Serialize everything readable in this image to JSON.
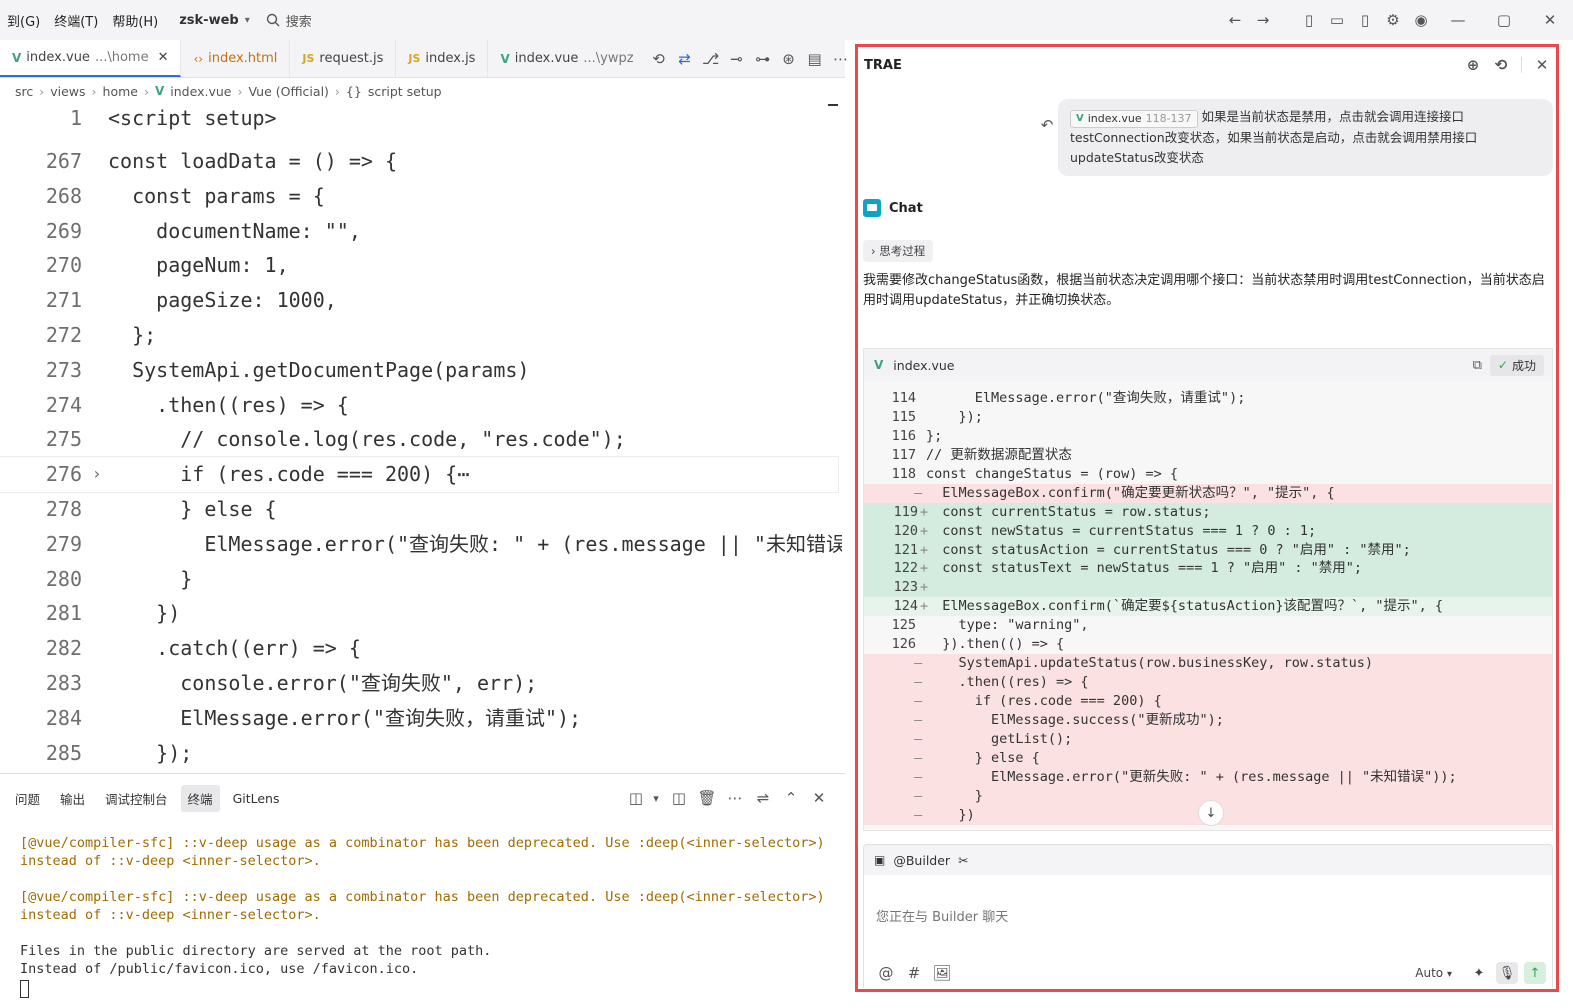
{
  "titlebar": {
    "menus": [
      "到(G)",
      "终端(T)",
      "帮助(H)"
    ],
    "project": "zsk-web",
    "search": "搜索"
  },
  "tabs": [
    {
      "icon": "vue",
      "name": "index.vue",
      "path": "...\\home",
      "active": true
    },
    {
      "icon": "html",
      "name": "index.html",
      "path": ""
    },
    {
      "icon": "js",
      "name": "request.js",
      "path": ""
    },
    {
      "icon": "js",
      "name": "index.js",
      "path": ""
    },
    {
      "icon": "vue",
      "name": "index.vue",
      "path": "...\\ywpz"
    }
  ],
  "breadcrumb": [
    "src",
    "views",
    "home",
    "index.vue",
    "Vue (Official)",
    "script setup"
  ],
  "code": [
    {
      "n": "1",
      "t": "<script setup>"
    },
    {
      "n": "267",
      "t": "const loadData = () => {"
    },
    {
      "n": "268",
      "t": "  const params = {"
    },
    {
      "n": "269",
      "t": "    documentName: \"\","
    },
    {
      "n": "270",
      "t": "    pageNum: 1,"
    },
    {
      "n": "271",
      "t": "    pageSize: 1000,"
    },
    {
      "n": "272",
      "t": "  };"
    },
    {
      "n": "273",
      "t": "  SystemApi.getDocumentPage(params)"
    },
    {
      "n": "274",
      "t": "    .then((res) => {"
    },
    {
      "n": "275",
      "t": "      // console.log(res.code, \"res.code\");"
    },
    {
      "n": "276",
      "t": "      if (res.code === 200) {⋯"
    },
    {
      "n": "278",
      "t": "      } else {"
    },
    {
      "n": "279",
      "t": "        ElMessage.error(\"查询失败: \" + (res.message || \"未知错误"
    },
    {
      "n": "280",
      "t": "      }"
    },
    {
      "n": "281",
      "t": "    })"
    },
    {
      "n": "282",
      "t": "    .catch((err) => {"
    },
    {
      "n": "283",
      "t": "      console.error(\"查询失败\", err);"
    },
    {
      "n": "284",
      "t": "      ElMessage.error(\"查询失败，请重试\");"
    },
    {
      "n": "285",
      "t": "    });"
    }
  ],
  "panel": {
    "tabs": [
      "问题",
      "输出",
      "调试控制台",
      "终端",
      "GitLens"
    ],
    "active": "终端",
    "terminal": [
      "[@vue/compiler-sfc] ::v-deep usage as a combinator has been deprecated. Use :deep(<inner-selector>) instead of ::v-deep <inner-selector>.",
      "",
      "[@vue/compiler-sfc] ::v-deep usage as a combinator has been deprecated. Use :deep(<inner-selector>) instead of ::v-deep <inner-selector>.",
      "",
      "Files in the public directory are served at the root path.",
      "Instead of /public/favicon.ico, use /favicon.ico."
    ]
  },
  "side": {
    "title": "TRAE",
    "user_msg": {
      "chip_file": "index.vue",
      "chip_range": "118-137",
      "text": "如果是当前状态是禁用，点击就会调用连接接口testConnection改变状态，如果当前状态是启动，点击就会调用禁用接口updateStatus改变状态"
    },
    "chat_label": "Chat",
    "thinking": "思考过程",
    "reply": "我需要修改changeStatus函数，根据当前状态决定调用哪个接口：当前状态禁用时调用testConnection，当前状态启用时调用updateStatus，并正确切换状态。",
    "diff_file": "index.vue",
    "diff_status": "成功",
    "diff_lines": [
      {
        "n": "114",
        "m": "",
        "k": "ctx",
        "t": "      ElMessage.error(\"查询失败，请重试\");"
      },
      {
        "n": "115",
        "m": "",
        "k": "ctx",
        "t": "    });"
      },
      {
        "n": "116",
        "m": "",
        "k": "ctx",
        "t": "};"
      },
      {
        "n": "117",
        "m": "",
        "k": "ctx",
        "t": "// 更新数据源配置状态"
      },
      {
        "n": "118",
        "m": "",
        "k": "ctx",
        "t": "const changeStatus = (row) => {"
      },
      {
        "n": "",
        "m": "—",
        "k": "del",
        "t": "  ElMessageBox.confirm(\"确定要更新状态吗？\", \"提示\", {"
      },
      {
        "n": "119",
        "m": "+",
        "k": "add",
        "t": "  const currentStatus = row.status;"
      },
      {
        "n": "120",
        "m": "+",
        "k": "add",
        "t": "  const newStatus = currentStatus === 1 ? 0 : 1;"
      },
      {
        "n": "121",
        "m": "+",
        "k": "add",
        "t": "  const statusAction = currentStatus === 0 ? \"启用\" : \"禁用\";"
      },
      {
        "n": "122",
        "m": "+",
        "k": "add",
        "t": "  const statusText = newStatus === 1 ? \"启用\" : \"禁用\";"
      },
      {
        "n": "123",
        "m": "+",
        "k": "add",
        "t": ""
      },
      {
        "n": "124",
        "m": "+",
        "k": "add2",
        "t": "  ElMessageBox.confirm(`确定要${statusAction}该配置吗？`, \"提示\", {"
      },
      {
        "n": "125",
        "m": "",
        "k": "ctx",
        "t": "    type: \"warning\","
      },
      {
        "n": "126",
        "m": "",
        "k": "ctx",
        "t": "  }).then(() => {"
      },
      {
        "n": "",
        "m": "—",
        "k": "del",
        "t": "    SystemApi.updateStatus(row.businessKey, row.status)"
      },
      {
        "n": "",
        "m": "—",
        "k": "del",
        "t": "    .then((res) => {"
      },
      {
        "n": "",
        "m": "—",
        "k": "del",
        "t": "      if (res.code === 200) {"
      },
      {
        "n": "",
        "m": "—",
        "k": "del",
        "t": "        ElMessage.success(\"更新成功\");"
      },
      {
        "n": "",
        "m": "—",
        "k": "del",
        "t": "        getList();"
      },
      {
        "n": "",
        "m": "—",
        "k": "del",
        "t": "      } else {"
      },
      {
        "n": "",
        "m": "—",
        "k": "del",
        "t": "        ElMessage.error(\"更新失败: \" + (res.message || \"未知错误\"));"
      },
      {
        "n": "",
        "m": "—",
        "k": "del",
        "t": "      }"
      },
      {
        "n": "",
        "m": "—",
        "k": "del",
        "t": "    })"
      }
    ],
    "builder_label": "@Builder",
    "input_placeholder": "您正在与 Builder 聊天",
    "mode": "Auto"
  },
  "colors": {
    "highlight_border": "#e84a4f",
    "accent": "#2d6be0",
    "diff_del": "#fbe1e1",
    "diff_add": "#d3ecdf"
  }
}
